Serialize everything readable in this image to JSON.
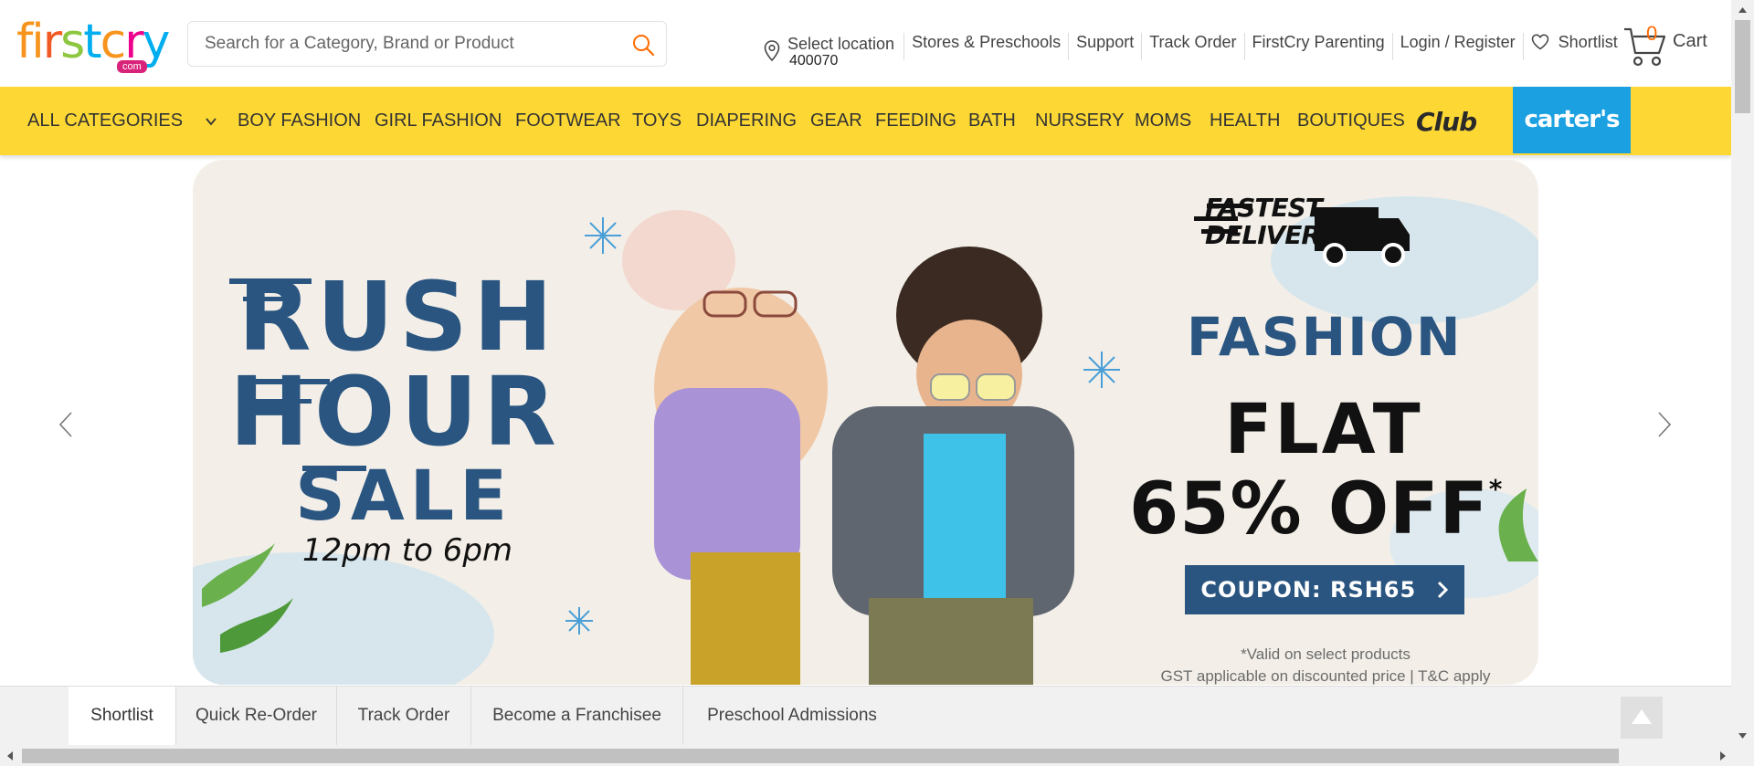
{
  "header": {
    "logo": {
      "text": "firstcry",
      "sub": "com"
    },
    "search": {
      "placeholder": "Search for a Category, Brand or Product"
    },
    "location": {
      "label": "Select location",
      "pincode": "400070"
    },
    "links": [
      "Stores & Preschools",
      "Support",
      "Track Order",
      "FirstCry Parenting",
      "Login / Register"
    ],
    "shortlist_label": "Shortlist",
    "cart": {
      "count": "0",
      "label": "Cart"
    }
  },
  "nav": {
    "all_categories": "ALL CATEGORIES",
    "items": [
      "BOY FASHION",
      "GIRL FASHION",
      "FOOTWEAR",
      "TOYS",
      "DIAPERING",
      "GEAR",
      "FEEDING",
      "BATH",
      "NURSERY",
      "MOMS",
      "HEALTH",
      "BOUTIQUES"
    ],
    "club_logo": "Club",
    "carters_logo": "carter's",
    "colors": {
      "bar": "#fdd835",
      "carters": "#1ba1e2"
    }
  },
  "banner": {
    "rush": [
      "RUSH",
      "HOUR",
      "SALE"
    ],
    "time": "12pm to 6pm",
    "fastest": [
      "FASTEST",
      "DELIVERY"
    ],
    "fashion": "FASHION",
    "flat": "FLAT",
    "off": "65% OFF",
    "asterisk": "*",
    "coupon": "COUPON: RSH65",
    "valid": "*Valid on select products",
    "gst": "GST applicable on discounted price | T&C apply",
    "colors": {
      "navy": "#2a5580",
      "background": "#f3efe8"
    }
  },
  "bottom_bar": {
    "items": [
      "Shortlist",
      "Quick Re-Order",
      "Track Order",
      "Become a Franchisee",
      "Preschool Admissions"
    ]
  }
}
